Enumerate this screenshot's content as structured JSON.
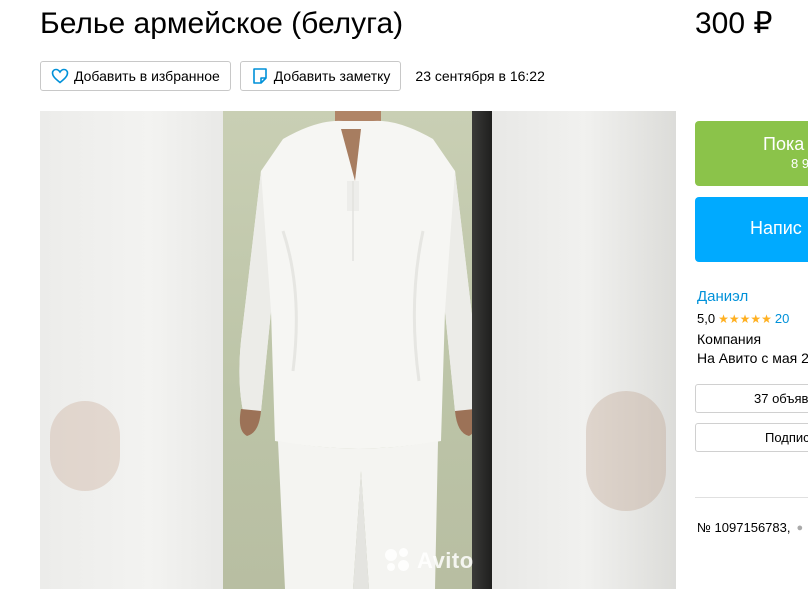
{
  "title": "Белье армейское (белуга)",
  "price": "300 ₽",
  "actions": {
    "favorite_label": "Добавить в избранное",
    "note_label": "Добавить заметку",
    "date": "23 сентября в 16:22"
  },
  "gallery": {
    "watermark": "Avito"
  },
  "contact": {
    "show_phone_label": "Пока",
    "phone_partial": "8 9",
    "message_label": "Напис"
  },
  "seller": {
    "name": "Даниэл",
    "rating": "5,0",
    "stars": "★★★★★",
    "reviews": "20",
    "type": "Компания",
    "since": "На Авито с мая 2",
    "listings_label": "37 объяв",
    "subscribe_label": "Подпис"
  },
  "item": {
    "number": "№ 1097156783,"
  },
  "colors": {
    "green": "#8bc34a",
    "blue": "#00aaff",
    "link": "#0091d9",
    "star": "#ffb021"
  }
}
